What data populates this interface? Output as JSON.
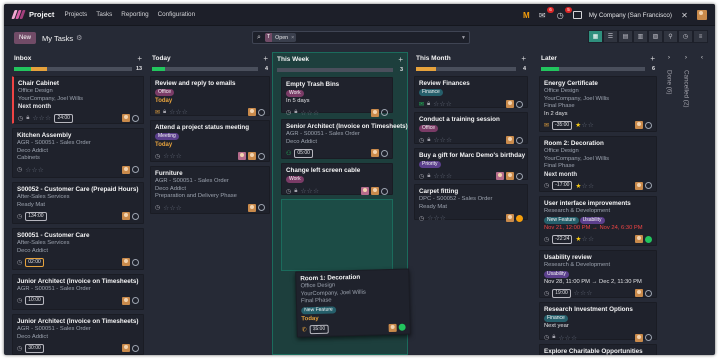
{
  "nav": {
    "app_name": "Project",
    "menu": [
      "Projects",
      "Tasks",
      "Reporting",
      "Configuration"
    ],
    "msg_count": "6",
    "activity_count": "5",
    "company": "My Company (San Francisco)"
  },
  "control": {
    "new_label": "New",
    "title": "My Tasks",
    "filter_type": "T",
    "filter_value": "Open"
  },
  "columns": [
    {
      "name": "Inbox",
      "count": "13",
      "progress": {
        "green": 0.14,
        "yellow": 0.14
      }
    },
    {
      "name": "Today",
      "count": "4",
      "progress": {
        "green": 0.12,
        "yellow": 0.0
      }
    },
    {
      "name": "This Week",
      "count": "3",
      "progress": {
        "green": 0.0,
        "yellow": 0.0
      }
    },
    {
      "name": "This Month",
      "count": "4",
      "progress": {
        "green": 0.0,
        "yellow": 0.2
      }
    },
    {
      "name": "Later",
      "count": "6",
      "progress": {
        "green": 0.17,
        "yellow": 0.0
      }
    }
  ],
  "folded": {
    "done": "Done (6)",
    "cancelled": "Cancelled (2)"
  },
  "cards": {
    "inbox": [
      {
        "title": "Chair Cabinet",
        "lines": [
          "Office Design",
          "YourCompany, Joel Willis"
        ],
        "deadline": "Next month",
        "timer": "24:00"
      },
      {
        "title": "Kitchen Assembly",
        "lines": [
          "AGR - S00051 - Sales Order",
          "Deco Addict",
          "Cabinets"
        ]
      },
      {
        "title": "S00052 - Customer Care (Prepaid Hours)",
        "lines": [
          "After-Sales Services",
          "Ready Mat"
        ],
        "timer": "134:00"
      },
      {
        "title": "S00051 - Customer Care",
        "lines": [
          "After-Sales Services",
          "Deco Addict"
        ],
        "timer": "02:00"
      },
      {
        "title": "Junior Architect (Invoice on Timesheets)",
        "lines": [
          "AGR - S00051 - Sales Order"
        ],
        "timer": "10:00"
      },
      {
        "title": "Junior Architect (Invoice on Timesheets)",
        "lines": [
          "AGR - S00051 - Sales Order",
          "Deco Addict"
        ],
        "timer": "30:00"
      }
    ],
    "today": [
      {
        "title": "Review and reply to emails",
        "tag": "Office",
        "deadline": "Today"
      },
      {
        "title": "Attend a project status meeting",
        "tag": "Meeting",
        "deadline": "Today"
      },
      {
        "title": "Furniture",
        "lines": [
          "AGR - S00051 - Sales Order",
          "Deco Addict",
          "Preparation and Delivery Phase"
        ]
      }
    ],
    "week": [
      {
        "title": "Empty Trash Bins",
        "tag": "Work",
        "deadline": "In 5 days"
      },
      {
        "title": "Senior Architect (Invoice on Timesheets)",
        "lines": [
          "AGR - S00051 - Sales Order",
          "Deco Addict"
        ],
        "timer": "05:00"
      },
      {
        "title": "Change left screen cable",
        "tag": "Work"
      }
    ],
    "dragged": {
      "title": "Room 1: Decoration",
      "lines": [
        "Office Design",
        "YourCompany, Joel Willis",
        "Final Phase"
      ],
      "tag": "New Feature",
      "deadline": "Today",
      "timer": "35:00"
    },
    "month": [
      {
        "title": "Review Finances",
        "tag": "Finance"
      },
      {
        "title": "Conduct a training session",
        "tag": "Office"
      },
      {
        "title": "Buy a gift for Marc Demo's birthday",
        "tag": "Priority"
      },
      {
        "title": "Carpet fitting",
        "lines": [
          "DPC - S00052 - Sales Order",
          "Ready Mat"
        ]
      }
    ],
    "later": [
      {
        "title": "Energy Certificate",
        "lines": [
          "Office Design",
          "YourCompany, Joel Willis",
          "Final Phase"
        ],
        "deadline": "In 2 days",
        "timer": "-35:00"
      },
      {
        "title": "Room 2: Decoration",
        "lines": [
          "Office Design",
          "YourCompany, Joel Willis",
          "Final Phase"
        ],
        "deadline": "Next month",
        "timer": "-17:00"
      },
      {
        "title": "User interface improvements",
        "lines": [
          "Research & Development"
        ],
        "tags": [
          "New Feature",
          "Usability"
        ],
        "range_from": "Nov 21, 12:00 PM",
        "range_to": "Nov 24, 6:30 PM",
        "timer": "-22:24"
      },
      {
        "title": "Usability review",
        "lines": [
          "Research & Development"
        ],
        "tag": "Usability",
        "range_from": "Nov 28, 11:00 PM",
        "range_to": "Dec 2, 11:30 PM",
        "timer": "19:00"
      },
      {
        "title": "Research Investment Options",
        "tag": "Finance",
        "deadline": "Next year"
      },
      {
        "title": "Explore Charitable Opportunities"
      }
    ]
  }
}
